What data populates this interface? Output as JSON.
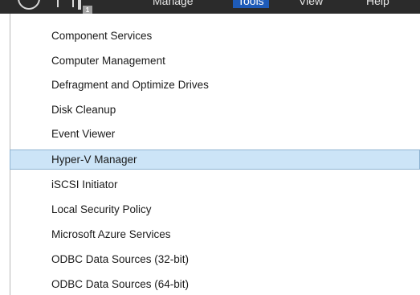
{
  "menubar": {
    "badge": "1",
    "items": [
      {
        "label": "Manage"
      },
      {
        "label": "Tools"
      },
      {
        "label": "View"
      },
      {
        "label": "Help"
      }
    ]
  },
  "colors": {
    "menubar_bg": "#2b2b2b",
    "active_menu": "#1e5bb8",
    "highlight_bg": "#cce4f7",
    "highlight_border": "#8fb3d1"
  },
  "tools_menu": {
    "highlighted": "Hyper-V Manager",
    "items": [
      {
        "label": "Component Services"
      },
      {
        "label": "Computer Management"
      },
      {
        "label": "Defragment and Optimize Drives"
      },
      {
        "label": "Disk Cleanup"
      },
      {
        "label": "Event Viewer"
      },
      {
        "label": "Hyper-V Manager"
      },
      {
        "label": "iSCSI Initiator"
      },
      {
        "label": "Local Security Policy"
      },
      {
        "label": "Microsoft Azure Services"
      },
      {
        "label": "ODBC Data Sources (32-bit)"
      },
      {
        "label": "ODBC Data Sources (64-bit)"
      }
    ]
  }
}
